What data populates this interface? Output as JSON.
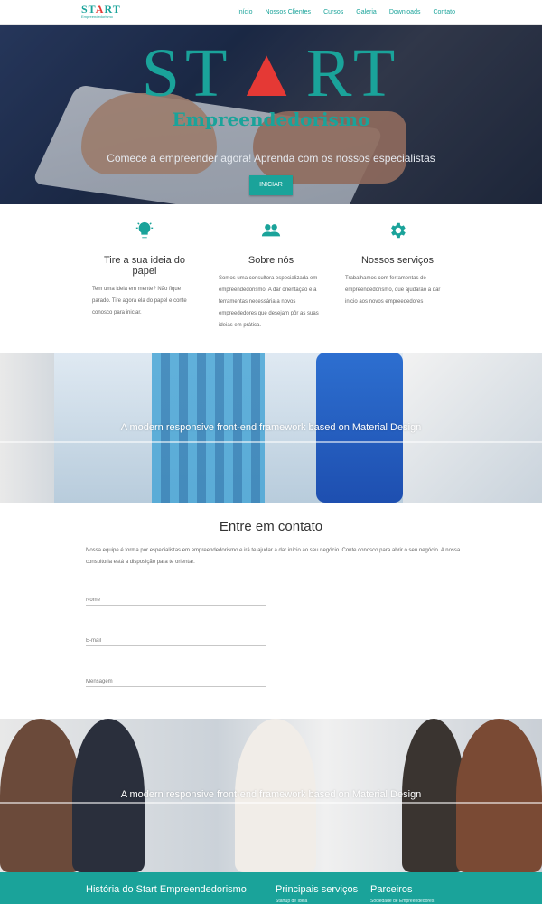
{
  "nav": {
    "logo_text": "START",
    "logo_sub": "Empreendedorismo",
    "links": [
      "Início",
      "Nossos Clientes",
      "Cursos",
      "Galeria",
      "Downloads",
      "Contato"
    ]
  },
  "hero": {
    "title": "START",
    "subtitle": "Empreendedorismo",
    "tagline": "Comece a empreender agora! Aprenda com os nossos especialistas",
    "button": "INICIAR"
  },
  "features": [
    {
      "icon": "lightbulb-icon",
      "title": "Tire a sua ideia do papel",
      "text": "Tem uma ideia em mente? Não fique parado. Tire agora ela do papel e conte conosco para iniciar."
    },
    {
      "icon": "group-icon",
      "title": "Sobre nós",
      "text": "Somos uma consultora especializada em empreendedorismo. A dar orientação e a ferramentas necessária a novos empreededores que desejam pôr as suas ideias em prática."
    },
    {
      "icon": "gear-icon",
      "title": "Nossos serviços",
      "text": "Trabalhamos com ferramentas de empreendedorismo, que ajudarão a dar inicio aos novos empreededores"
    }
  ],
  "parallax1_text": "A modern responsive front-end framework based on Material Design",
  "contact": {
    "title": "Entre em contato",
    "text": "Nossa equipe é forma por especialistas em empreendedorismo e irá te ajudar a dar início ao seu negócio. Conte conosco para abrir o seu negócio. A nossa consultoria está a disposição para te orientar.",
    "fields": {
      "name_placeholder": "Nome",
      "email_placeholder": "E-mail",
      "message_placeholder": "Mensagem"
    }
  },
  "parallax2_text": "A modern responsive front-end framework based on Material Design",
  "footer": {
    "history": "História do Start Empreendedorismo",
    "services": "Principais serviços",
    "partners": "Parceiros",
    "services_sub": "Startup de Ideia",
    "partners_sub": "Sociedade de Empreendedores"
  },
  "colors": {
    "accent": "#1aa39a",
    "accent_red": "#e53935"
  }
}
